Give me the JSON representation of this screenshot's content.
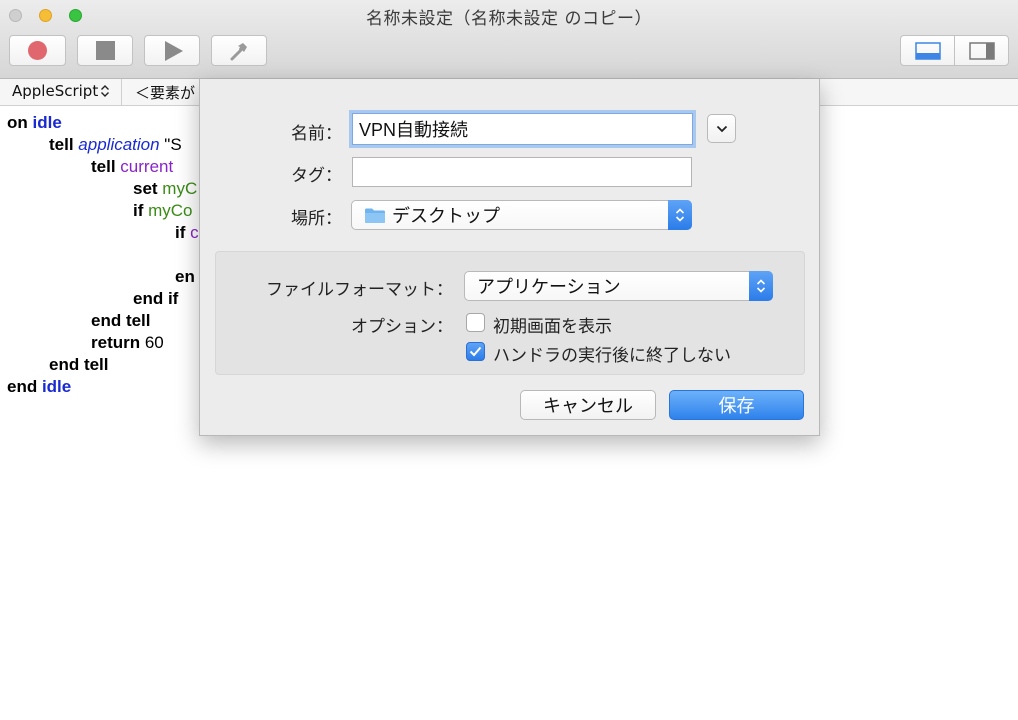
{
  "window": {
    "title": "名称未設定（名称未設定 のコピー）"
  },
  "toolbar": {
    "record_icon": "record-icon",
    "stop_icon": "stop-icon",
    "run_icon": "play-icon",
    "compile_icon": "hammer-icon"
  },
  "navbar": {
    "language": "AppleScript",
    "element_selector": "＜要素が"
  },
  "script": {
    "lines": [
      [
        {
          "t": "on ",
          "c": "kw"
        },
        {
          "t": "idle",
          "c": "blue"
        }
      ],
      [
        {
          "t": "tell ",
          "c": "kw"
        },
        {
          "t": "application",
          "c": "appcls"
        },
        {
          "t": " \"S",
          "c": "plain"
        }
      ],
      [
        {
          "t": "tell ",
          "c": "kw"
        },
        {
          "t": "current",
          "c": "purple"
        }
      ],
      [
        {
          "t": "set ",
          "c": "kw"
        },
        {
          "t": "myC",
          "c": "green"
        }
      ],
      [
        {
          "t": "if ",
          "c": "kw"
        },
        {
          "t": "myCo",
          "c": "green"
        }
      ],
      [
        {
          "t": "if ",
          "c": "kw"
        },
        {
          "t": "c",
          "c": "purple"
        }
      ],
      [],
      [
        {
          "t": "en",
          "c": "kw"
        }
      ],
      [
        {
          "t": "end if",
          "c": "kw"
        }
      ],
      [
        {
          "t": "end tell",
          "c": "kw"
        }
      ],
      [
        {
          "t": "return ",
          "c": "kw"
        },
        {
          "t": "60",
          "c": "plain"
        }
      ],
      [
        {
          "t": "end tell",
          "c": "kw"
        }
      ],
      [
        {
          "t": "end ",
          "c": "kw"
        },
        {
          "t": "idle",
          "c": "blue"
        }
      ]
    ]
  },
  "save_sheet": {
    "name_label": "名前：",
    "name_value": "VPN自動接続",
    "tags_label": "タグ：",
    "tags_value": "",
    "location_label": "場所：",
    "location_value": "デスクトップ",
    "format_label": "ファイルフォーマット：",
    "format_value": "アプリケーション",
    "options_label": "オプション：",
    "option_startup_label": "初期画面を表示",
    "option_startup_checked": false,
    "option_stay_open_label": "ハンドラの実行後に終了しない",
    "option_stay_open_checked": true,
    "cancel_label": "キャンセル",
    "save_label": "保存"
  },
  "colors": {
    "accent": "#2f82ec",
    "record": "#e0676d",
    "keyword_blue": "#1a2ad2",
    "keyword_purple": "#8a23c9",
    "variable_green": "#3b8c17"
  }
}
